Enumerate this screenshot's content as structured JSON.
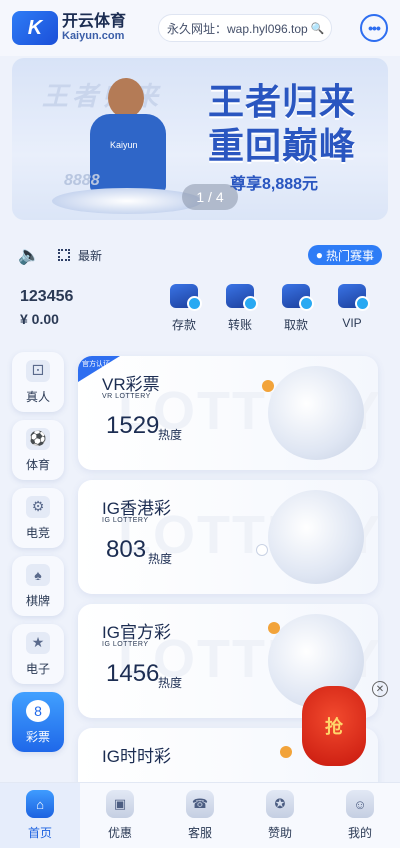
{
  "header": {
    "logo_cn": "开云体育",
    "logo_en": "Kaiyun.com",
    "logo_mark": "K",
    "url_text": "永久网址：wap.hyl096.top",
    "search_icon": "search-icon",
    "chat_icon": "chat-bubble-icon"
  },
  "banner": {
    "title_line1": "王者归来",
    "title_line2": "重回巅峰",
    "subtitle": "尊享8,888元",
    "pager": "1 / 4",
    "jersey_brand": "Kaiyun",
    "chips_text": "8888"
  },
  "notice": {
    "speaker_icon": "speaker-icon",
    "latest_label": "最新",
    "hot_badge": "热门赛事"
  },
  "account": {
    "username": "123456",
    "balance": "¥ 0.00",
    "actions": [
      {
        "label": "存款",
        "icon": "wallet-icon"
      },
      {
        "label": "转账",
        "icon": "transfer-icon"
      },
      {
        "label": "取款",
        "icon": "card-icon"
      },
      {
        "label": "VIP",
        "icon": "vip-shield-icon"
      }
    ]
  },
  "categories": [
    {
      "label": "真人",
      "icon": "dice-icon"
    },
    {
      "label": "体育",
      "icon": "soccer-ball-icon"
    },
    {
      "label": "电竞",
      "icon": "gamepad-icon"
    },
    {
      "label": "棋牌",
      "icon": "cards-icon"
    },
    {
      "label": "电子",
      "icon": "slot-machine-icon"
    },
    {
      "label": "彩票",
      "icon": "lottery-ball-icon"
    }
  ],
  "active_category": "彩票",
  "lottery_cards": [
    {
      "name": "VR彩票",
      "sub": "VR LOTTERY",
      "heat": "1529",
      "heat_label": "热度",
      "watermark": "LOTTERY",
      "official_tag": "官方认证"
    },
    {
      "name": "IG香港彩",
      "sub": "IG LOTTERY",
      "heat": "803",
      "heat_label": "热度",
      "watermark": "LOTTERY"
    },
    {
      "name": "IG官方彩",
      "sub": "IG LOTTERY",
      "heat": "1456",
      "heat_label": "热度",
      "watermark": "LOTTERY"
    },
    {
      "name": "IG时时彩",
      "sub": "",
      "heat": "",
      "heat_label": "",
      "watermark": ""
    }
  ],
  "red_envelope": {
    "label": "抢",
    "close_icon": "close-icon"
  },
  "bottom_nav": [
    {
      "label": "首页",
      "icon": "home-icon"
    },
    {
      "label": "优惠",
      "icon": "gift-icon"
    },
    {
      "label": "客服",
      "icon": "headset-icon"
    },
    {
      "label": "赞助",
      "icon": "medal-icon"
    },
    {
      "label": "我的",
      "icon": "user-icon"
    }
  ],
  "active_nav": "首页"
}
